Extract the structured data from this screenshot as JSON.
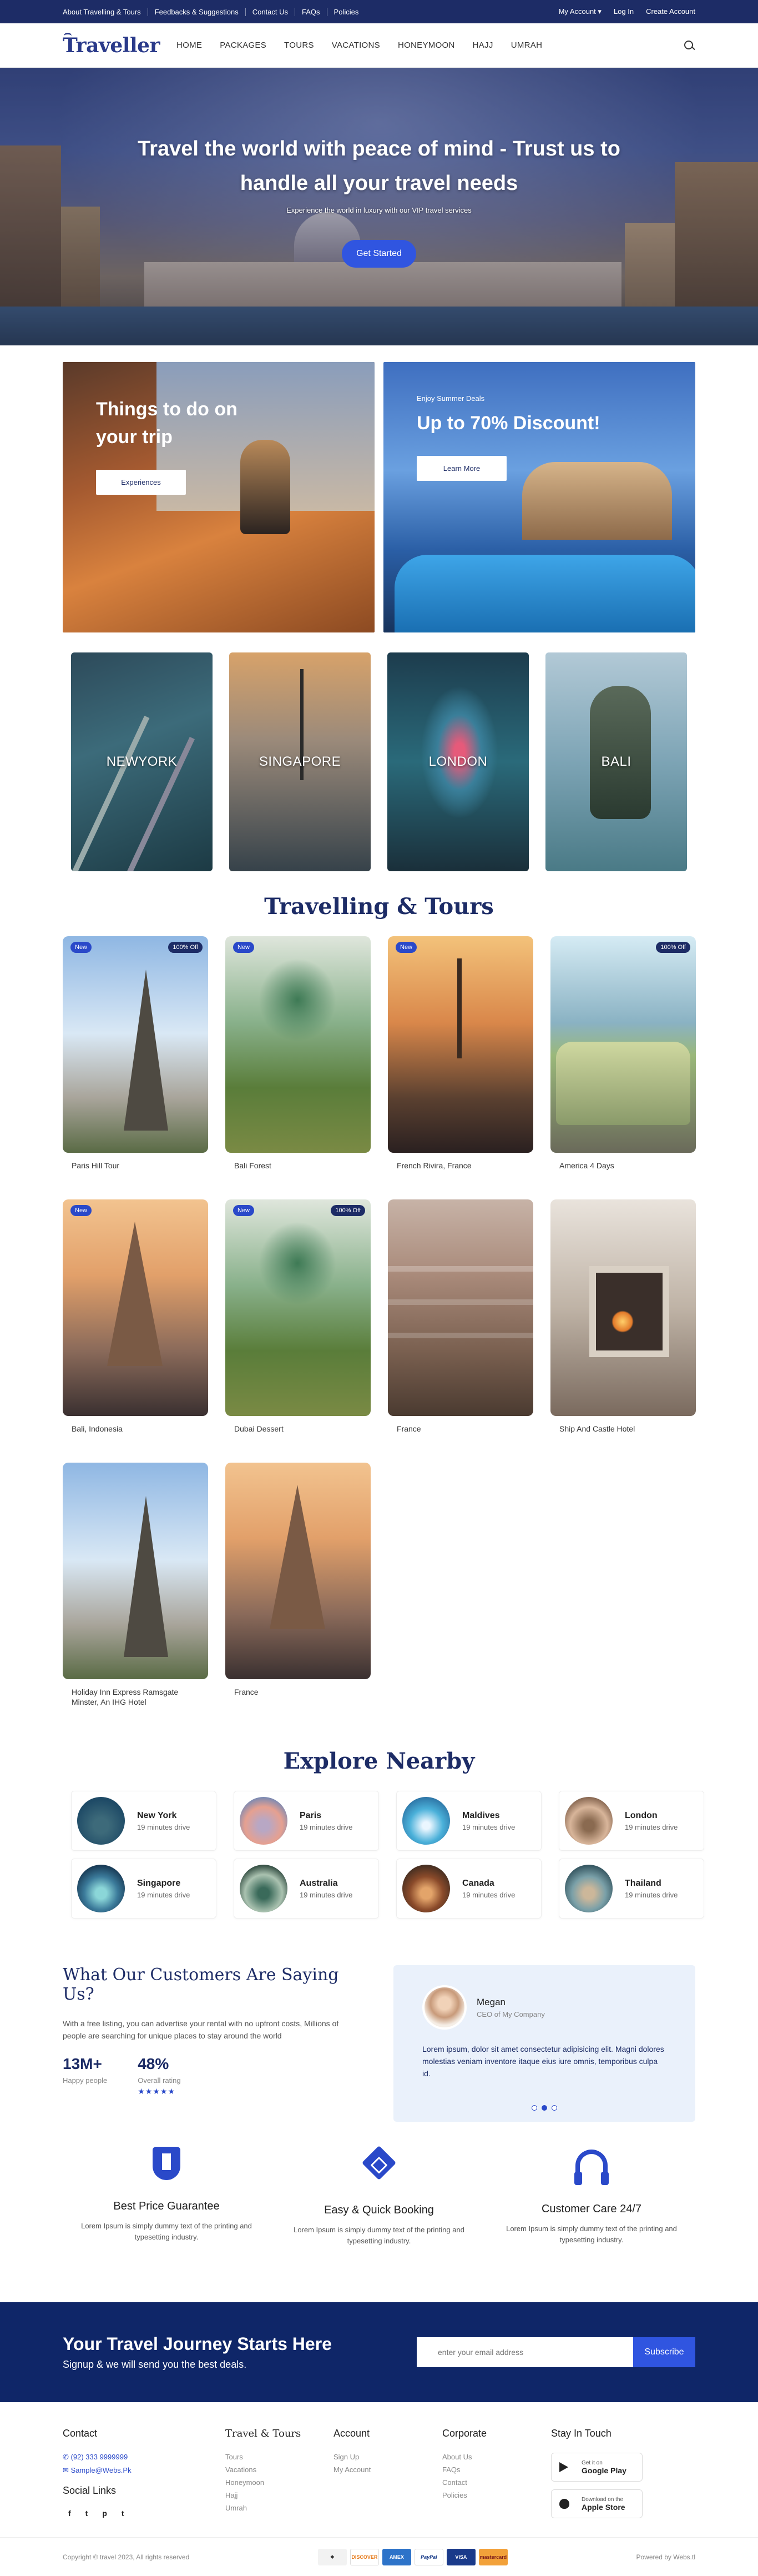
{
  "topbar": {
    "links": [
      "About Travelling & Tours",
      "Feedbacks & Suggestions",
      "Contact Us",
      "FAQs",
      "Policies"
    ],
    "my_account": "My Account",
    "login": "Log In",
    "create_account": "Create Account"
  },
  "nav": {
    "logo": "Traveller",
    "menu": [
      "HOME",
      "PACKAGES",
      "TOURS",
      "VACATIONS",
      "HONEYMOON",
      "HAJJ",
      "UMRAH"
    ]
  },
  "hero": {
    "title_line1": "Travel the world with peace of mind - Trust us to",
    "title_line2": "handle all your travel needs",
    "subtitle": "Experience the world in luxury with our VIP travel services",
    "cta": "Get Started"
  },
  "promos": {
    "left": {
      "title_line1": "Things to do on",
      "title_line2": "your trip",
      "button": "Experiences"
    },
    "right": {
      "eyebrow": "Enjoy Summer Deals",
      "title": "Up to 70% Discount!",
      "button": "Learn More"
    }
  },
  "cities": [
    "NEWYORK",
    "SINGAPORE",
    "LONDON",
    "BALI"
  ],
  "tours_section": {
    "title": "Travelling & Tours",
    "items": [
      {
        "name": "Paris Hill Tour",
        "new": "New",
        "off": "100% Off"
      },
      {
        "name": "Bali Forest",
        "new": "New",
        "off": ""
      },
      {
        "name": "French Rivira, France",
        "new": "New",
        "off": ""
      },
      {
        "name": "America 4 Days",
        "new": "",
        "off": "100% Off"
      },
      {
        "name": "Bali, Indonesia",
        "new": "New",
        "off": ""
      },
      {
        "name": "Dubai Dessert",
        "new": "New",
        "off": "100% Off"
      },
      {
        "name": "France",
        "new": "",
        "off": ""
      },
      {
        "name": "Ship And Castle Hotel",
        "new": "",
        "off": ""
      },
      {
        "name": "Holiday Inn Express Ramsgate Minster, An IHG Hotel",
        "new": "",
        "off": ""
      },
      {
        "name": "France",
        "new": "",
        "off": ""
      }
    ]
  },
  "nearby": {
    "title": "Explore Nearby",
    "items": [
      {
        "name": "New York",
        "drive": "19 minutes drive"
      },
      {
        "name": "Paris",
        "drive": "19 minutes drive"
      },
      {
        "name": "Maldives",
        "drive": "19 minutes drive"
      },
      {
        "name": "London",
        "drive": "19 minutes drive"
      },
      {
        "name": "Singapore",
        "drive": "19 minutes drive"
      },
      {
        "name": "Australia",
        "drive": "19 minutes drive"
      },
      {
        "name": "Canada",
        "drive": "19 minutes drive"
      },
      {
        "name": "Thailand",
        "drive": "19 minutes drive"
      }
    ]
  },
  "testimonials": {
    "title": "What Our Customers Are Saying Us?",
    "lead": "With a free listing, you can advertise your rental with no upfront costs, Millions of people are searching for unique places to stay around the world",
    "stat1_value": "13M+",
    "stat1_label": "Happy people",
    "stat2_value": "48%",
    "stat2_label": "Overall rating",
    "stars": "★★★★★",
    "name": "Megan",
    "role": "CEO of My Company",
    "quote": "Lorem ipsum, dolor sit amet consectetur adipisicing elit. Magni dolores molestias veniam inventore itaque eius iure omnis, temporibus culpa id."
  },
  "features": [
    {
      "title": "Best Price Guarantee",
      "desc": "Lorem Ipsum is simply dummy text of the printing and typesetting industry."
    },
    {
      "title": "Easy & Quick Booking",
      "desc": "Lorem Ipsum is simply dummy text of the printing and typesetting industry."
    },
    {
      "title": "Customer Care 24/7",
      "desc": "Lorem Ipsum is simply dummy text of the printing and typesetting industry."
    }
  ],
  "subscribe": {
    "title": "Your Travel Journey Starts Here",
    "subtitle": "Signup & we will send you the best deals.",
    "placeholder": "enter your email address",
    "button": "Subscribe"
  },
  "footer": {
    "contact_title": "Contact",
    "phone": "(92) 333 9999999",
    "email": "Sample@Webs.Pk",
    "social_title": "Social Links",
    "social": [
      "f",
      "t",
      "p",
      "t"
    ],
    "tours_title": "Travel & Tours",
    "tours_links": [
      "Tours",
      "Vacations",
      "Honeymoon",
      "Hajj",
      "Umrah"
    ],
    "account_title": "Account",
    "account_links": [
      "Sign Up",
      "My Account"
    ],
    "corporate_title": "Corporate",
    "corporate_links": [
      "About Us",
      "FAQs",
      "Contact",
      "Policies"
    ],
    "stay_title": "Stay In Touch",
    "google_small": "Get it on",
    "google_big": "Google Play",
    "apple_small": "Download on the",
    "apple_big": "Apple Store",
    "copyright": "Copyright © travel 2023, All rights reserved",
    "payments": [
      "DISCOVER",
      "AMEX",
      "PayPal",
      "VISA",
      "mastercard"
    ],
    "powered": "Powered by Webs.tl"
  },
  "colors": {
    "brand": "#1d2c66",
    "accent": "#3055e0"
  }
}
